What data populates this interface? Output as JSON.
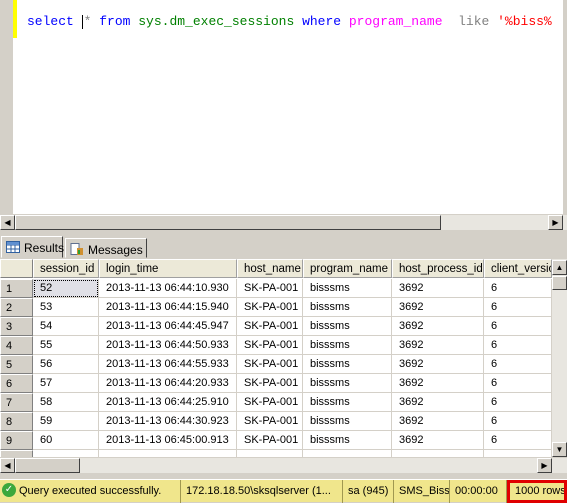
{
  "editor": {
    "tokens": {
      "select": "select ",
      "star": "* ",
      "from": "from ",
      "obj": "sys.dm_exec_sessions ",
      "where": "where ",
      "col": "program_name  ",
      "like": "like ",
      "str": "'%biss%"
    }
  },
  "tabs": [
    {
      "label": "Results",
      "icon": "grid-icon"
    },
    {
      "label": "Messages",
      "icon": "messages-icon"
    }
  ],
  "grid": {
    "columns": [
      "session_id",
      "login_time",
      "host_name",
      "program_name",
      "host_process_id",
      "client_version"
    ],
    "rows": [
      [
        "1",
        "52",
        "2013-11-13 06:44:10.930",
        "SK-PA-001",
        "bisssms",
        "3692",
        "6"
      ],
      [
        "2",
        "53",
        "2013-11-13 06:44:15.940",
        "SK-PA-001",
        "bisssms",
        "3692",
        "6"
      ],
      [
        "3",
        "54",
        "2013-11-13 06:44:45.947",
        "SK-PA-001",
        "bisssms",
        "3692",
        "6"
      ],
      [
        "4",
        "55",
        "2013-11-13 06:44:50.933",
        "SK-PA-001",
        "bisssms",
        "3692",
        "6"
      ],
      [
        "5",
        "56",
        "2013-11-13 06:44:55.933",
        "SK-PA-001",
        "bisssms",
        "3692",
        "6"
      ],
      [
        "6",
        "57",
        "2013-11-13 06:44:20.933",
        "SK-PA-001",
        "bisssms",
        "3692",
        "6"
      ],
      [
        "7",
        "58",
        "2013-11-13 06:44:25.910",
        "SK-PA-001",
        "bisssms",
        "3692",
        "6"
      ],
      [
        "8",
        "59",
        "2013-11-13 06:44:30.923",
        "SK-PA-001",
        "bisssms",
        "3692",
        "6"
      ],
      [
        "9",
        "60",
        "2013-11-13 06:45:00.913",
        "SK-PA-001",
        "bisssms",
        "3692",
        "6"
      ]
    ]
  },
  "status": {
    "message": "Query executed successfully.",
    "server": "172.18.18.50\\sksqlserver (1...",
    "user": "sa (945)",
    "database": "SMS_Biss",
    "time": "00:00:00",
    "rows": "1000 rows",
    "colors": {
      "bar": "#f0e68c",
      "highlight": "#e00000"
    }
  }
}
